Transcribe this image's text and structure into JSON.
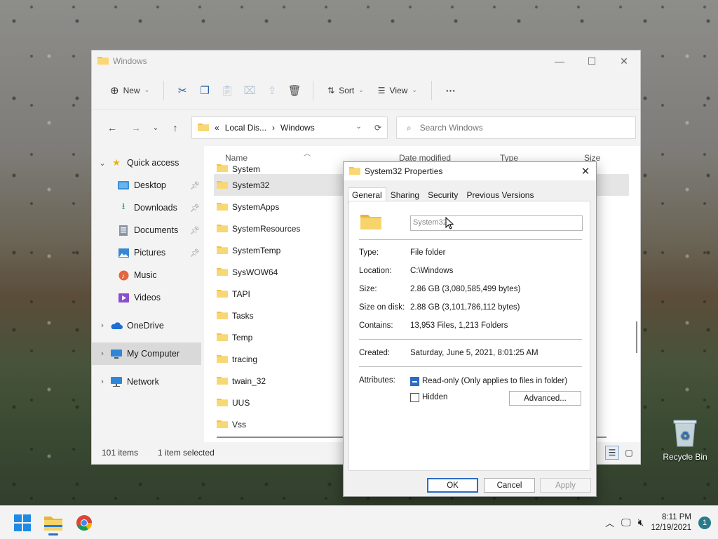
{
  "explorer": {
    "title": "Windows",
    "toolbar": {
      "new_label": "New",
      "sort_label": "Sort",
      "view_label": "View",
      "more_label": "···"
    },
    "address": {
      "prefix": "«",
      "part1": "Local Dis...",
      "separator": "›",
      "part2": "Windows"
    },
    "search_placeholder": "Search Windows",
    "columns": {
      "name": "Name",
      "date": "Date modified",
      "type": "Type",
      "size": "Size"
    },
    "sidebar": {
      "quick_access": "Quick access",
      "items": [
        "Desktop",
        "Downloads",
        "Documents",
        "Pictures",
        "Music",
        "Videos"
      ],
      "onedrive": "OneDrive",
      "my_computer": "My Computer",
      "network": "Network"
    },
    "files": {
      "partial": "System",
      "rows": [
        "System32",
        "SystemApps",
        "SystemResources",
        "SystemTemp",
        "SysWOW64",
        "TAPI",
        "Tasks",
        "Temp",
        "tracing",
        "twain_32",
        "UUS",
        "Vss"
      ]
    },
    "status": {
      "items": "101 items",
      "selected": "1 item selected"
    }
  },
  "properties": {
    "title": "System32 Properties",
    "tabs": [
      "General",
      "Sharing",
      "Security",
      "Previous Versions"
    ],
    "name_value": "System32",
    "rows": {
      "type_k": "Type:",
      "type_v": "File folder",
      "location_k": "Location:",
      "location_v": "C:\\Windows",
      "size_k": "Size:",
      "size_v": "2.86 GB (3,080,585,499 bytes)",
      "disk_k": "Size on disk:",
      "disk_v": "2.88 GB (3,101,786,112 bytes)",
      "contains_k": "Contains:",
      "contains_v": "13,953 Files, 1,213 Folders",
      "created_k": "Created:",
      "created_v": "Saturday, June 5, 2021, 8:01:25 AM",
      "attributes_k": "Attributes:"
    },
    "readonly_label": "Read-only (Only applies to files in folder)",
    "hidden_label": "Hidden",
    "advanced_label": "Advanced...",
    "ok_label": "OK",
    "cancel_label": "Cancel",
    "apply_label": "Apply"
  },
  "desktop": {
    "recycle_label": "Recycle Bin"
  },
  "taskbar": {
    "time": "8:11 PM",
    "date": "12/19/2021",
    "notifications": "1"
  }
}
